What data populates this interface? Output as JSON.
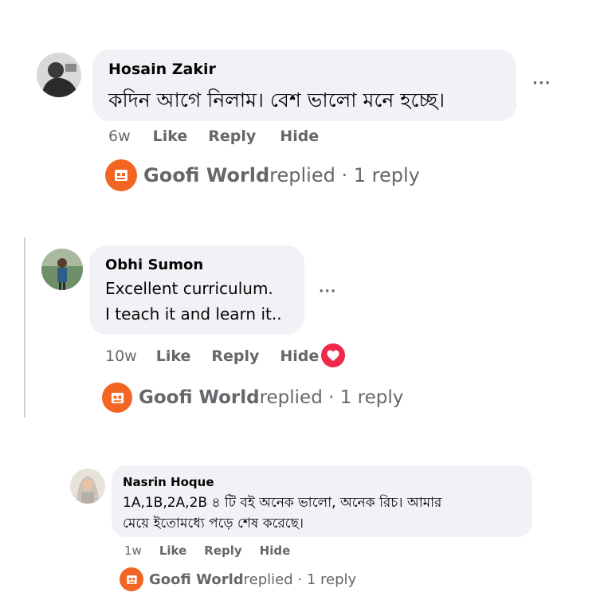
{
  "comments": [
    {
      "author": "Hosain Zakir",
      "text_lines": [
        "কদিন আগে নিলাম। বেশ ভালো মনে হচ্ছে।"
      ],
      "time": "6w",
      "actions": {
        "like": "Like",
        "reply": "Reply",
        "hide": "Hide"
      },
      "more": "···",
      "replied": {
        "page": "Goofi World",
        "suffix": " replied · 1 reply"
      }
    },
    {
      "author": "Obhi Sumon",
      "text_lines": [
        "Excellent curriculum.",
        "I teach it and learn it.."
      ],
      "time": "10w",
      "actions": {
        "like": "Like",
        "reply": "Reply",
        "hide": "Hide"
      },
      "more": "···",
      "reaction_icon": "heart-icon",
      "replied": {
        "page": "Goofi World",
        "suffix": " replied · 1 reply"
      }
    },
    {
      "author": "Nasrin Hoque",
      "text_lines": [
        "1A,1B,2A,2B ৪ টি বই অনেক ভালো, অনেক রিচ। আমার",
        "মেয়ে ইতোমধ্যে পড়ে শেষ করেছে।"
      ],
      "time": "1w",
      "actions": {
        "like": "Like",
        "reply": "Reply",
        "hide": "Hide"
      },
      "replied": {
        "page": "Goofi World",
        "suffix": " replied · 1 reply"
      }
    }
  ],
  "colors": {
    "bubble": "#f0f2f5",
    "meta": "#65676b",
    "page_avatar": "#f26522",
    "heart": "#f0284a"
  }
}
